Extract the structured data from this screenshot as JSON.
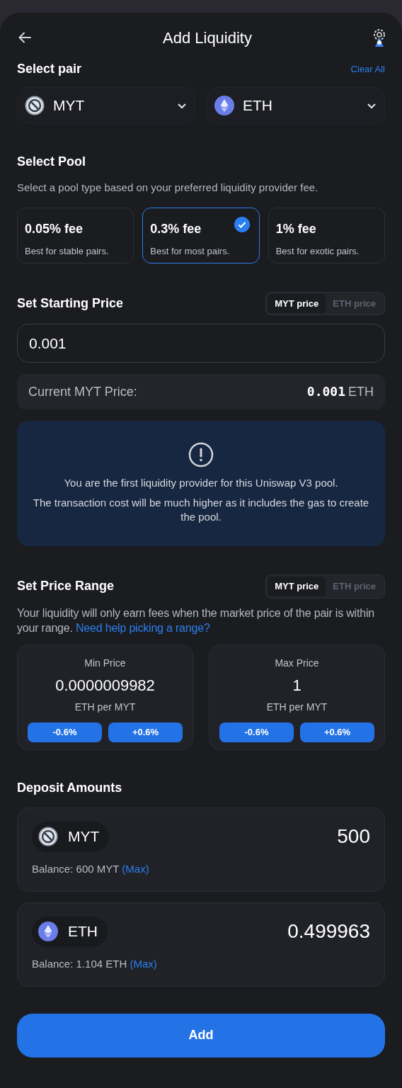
{
  "header": {
    "title": "Add Liquidity"
  },
  "pair": {
    "title": "Select pair",
    "clear": "Clear All",
    "tokens": [
      {
        "kind": "myt",
        "symbol": "MYT"
      },
      {
        "kind": "eth",
        "symbol": "ETH"
      }
    ]
  },
  "pool": {
    "title": "Select Pool",
    "description": "Select a pool type based on your preferred liquidity provider fee.",
    "options": [
      {
        "fee": "0.05% fee",
        "note": "Best for stable pairs.",
        "selected": false
      },
      {
        "fee": "0.3% fee",
        "note": "Best for most pairs.",
        "selected": true
      },
      {
        "fee": "1% fee",
        "note": "Best for exotic pairs.",
        "selected": false
      }
    ]
  },
  "starting_price": {
    "title": "Set Starting Price",
    "toggle": [
      {
        "label": "MYT price",
        "selected": true
      },
      {
        "label": "ETH price",
        "selected": false
      }
    ],
    "value": "0.001",
    "current_label": "Current MYT Price:",
    "current_value": "0.001",
    "current_unit": "ETH"
  },
  "notice": {
    "lines": [
      "You are the first liquidity provider for this Uniswap V3 pool.",
      "The transaction cost will be much higher as it includes the gas to create the pool."
    ]
  },
  "price_range": {
    "title": "Set Price Range",
    "toggle": [
      {
        "label": "MYT price",
        "selected": true
      },
      {
        "label": "ETH price",
        "selected": false
      }
    ],
    "description": "Your liquidity will only earn fees when the market price of the pair is within your range.",
    "help_link": "Need help picking a range?",
    "bounds": [
      {
        "label": "Min Price",
        "value": "0.0000009982",
        "unit": "ETH per MYT",
        "buttons": [
          "-0.6%",
          "+0.6%"
        ]
      },
      {
        "label": "Max Price",
        "value": "1",
        "unit": "ETH per MYT",
        "buttons": [
          "-0.6%",
          "+0.6%"
        ]
      }
    ]
  },
  "deposit": {
    "title": "Deposit Amounts",
    "items": [
      {
        "kind": "myt",
        "symbol": "MYT",
        "amount": "500",
        "balance": "Balance: 600 MYT",
        "max": "(Max)"
      },
      {
        "kind": "eth",
        "symbol": "ETH",
        "amount": "0.499963",
        "balance": "Balance: 1.104 ETH",
        "max": "(Max)"
      }
    ]
  },
  "submit": "Add"
}
